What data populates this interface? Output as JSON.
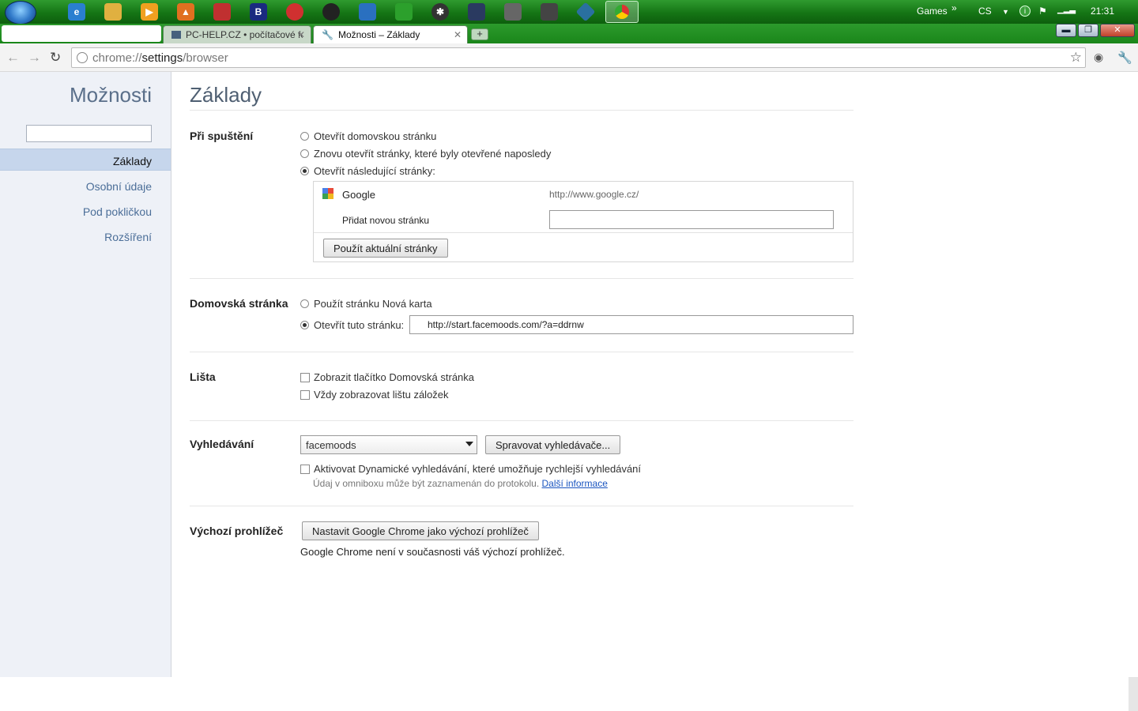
{
  "taskbar": {
    "icons": [
      "ie-icon",
      "folder-icon",
      "media-icon",
      "vlc-icon",
      "app-icon",
      "bold-b-icon",
      "red-icon",
      "dark-icon",
      "outlook-icon",
      "green-icon",
      "pinwheel-icon",
      "chat-icon",
      "tool-icon",
      "calculator-icon",
      "network-icon",
      "chrome-icon"
    ],
    "games_label": "Games",
    "chevron": "»",
    "language": "CS",
    "clock": "21:31"
  },
  "tabs": [
    {
      "label": "PC-HELP.CZ • počítačové fórum"
    },
    {
      "label": "Možnosti – Základy"
    }
  ],
  "toolbar": {
    "url_scheme": "chrome://",
    "url_host": "settings",
    "url_path": "/browser"
  },
  "sidebar": {
    "title": "Možnosti",
    "items": [
      {
        "label": "Základy"
      },
      {
        "label": "Osobní údaje"
      },
      {
        "label": "Pod pokličkou"
      },
      {
        "label": "Rozšíření"
      }
    ]
  },
  "main": {
    "title": "Základy",
    "startup": {
      "label": "Při spuštění",
      "opt_home": "Otevřít domovskou stránku",
      "opt_reopen": "Znovu otevřít stránky, které byly otevřené naposledy",
      "opt_pages": "Otevřít následující stránky:",
      "page_name": "Google",
      "page_url": "http://www.google.cz/",
      "add_page": "Přidat novou stránku",
      "use_current": "Použít aktuální stránky"
    },
    "homepage": {
      "label": "Domovská stránka",
      "opt_newtab": "Použít stránku Nová karta",
      "opt_open": "Otevřít tuto stránku:",
      "url": "http://start.facemoods.com/?a=ddrnw"
    },
    "toolbar_sec": {
      "label": "Lišta",
      "show_home": "Zobrazit tlačítko Domovská stránka",
      "show_bookmarks": "Vždy zobrazovat lištu záložek"
    },
    "search": {
      "label": "Vyhledávání",
      "engine": "facemoods",
      "manage": "Spravovat vyhledávače...",
      "instant": "Aktivovat Dynamické vyhledávání, které umožňuje rychlejší vyhledávání",
      "note": "Údaj v omniboxu může být zaznamenán do protokolu.",
      "more_link": "Další informace"
    },
    "default_browser": {
      "label": "Výchozí prohlížeč",
      "set_button": "Nastavit Google Chrome jako výchozí prohlížeč",
      "status": "Google Chrome není v současnosti váš výchozí prohlížeč."
    }
  }
}
